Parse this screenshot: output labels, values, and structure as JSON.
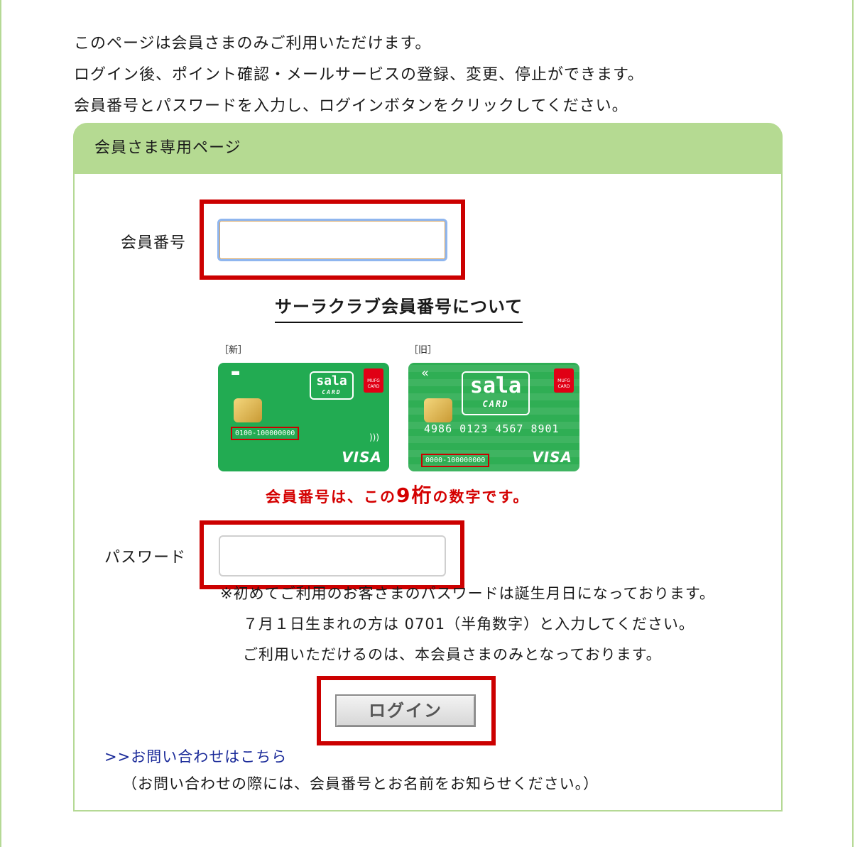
{
  "intro": {
    "line1": "このページは会員さまのみご利用いただけます。",
    "line2": "ログイン後、ポイント確認・メールサービスの登録、変更、停止ができます。",
    "line3": "会員番号とパスワードを入力し、ログインボタンをクリックしてください。"
  },
  "panel": {
    "title": "会員さま専用ページ"
  },
  "member": {
    "label": "会員番号",
    "value": "",
    "about_link": "サーラクラブ会員番号について"
  },
  "cards": {
    "new_tag": "［新］",
    "old_tag": "［旧］",
    "new_number": "0100-100000000",
    "old_number": "0000-100000000",
    "old_card_number": "4986 0123 4567 8901",
    "brand": "sala",
    "brand_sub": "CARD",
    "issuer": "MUFG CARD",
    "network": "VISA"
  },
  "note_red": {
    "pre": "会員番号は、この",
    "big": "9桁",
    "post": "の数字です。"
  },
  "password": {
    "label": "パスワード",
    "value": "",
    "note1": "※初めてご利用のお客さまのパスワードは誕生月日になっております。",
    "note2": "７月１日生まれの方は 0701（半角数字）と入力してください。",
    "note3": "ご利用いただけるのは、本会員さまのみとなっております。"
  },
  "login_button": "ログイン",
  "contact": {
    "link": ">>お問い合わせはこちら",
    "note": "（お問い合わせの際には、会員番号とお名前をお知らせください。）"
  },
  "colors": {
    "header_green": "#b5da92",
    "highlight_red": "#cc0000",
    "link_blue": "#1a2a99"
  }
}
